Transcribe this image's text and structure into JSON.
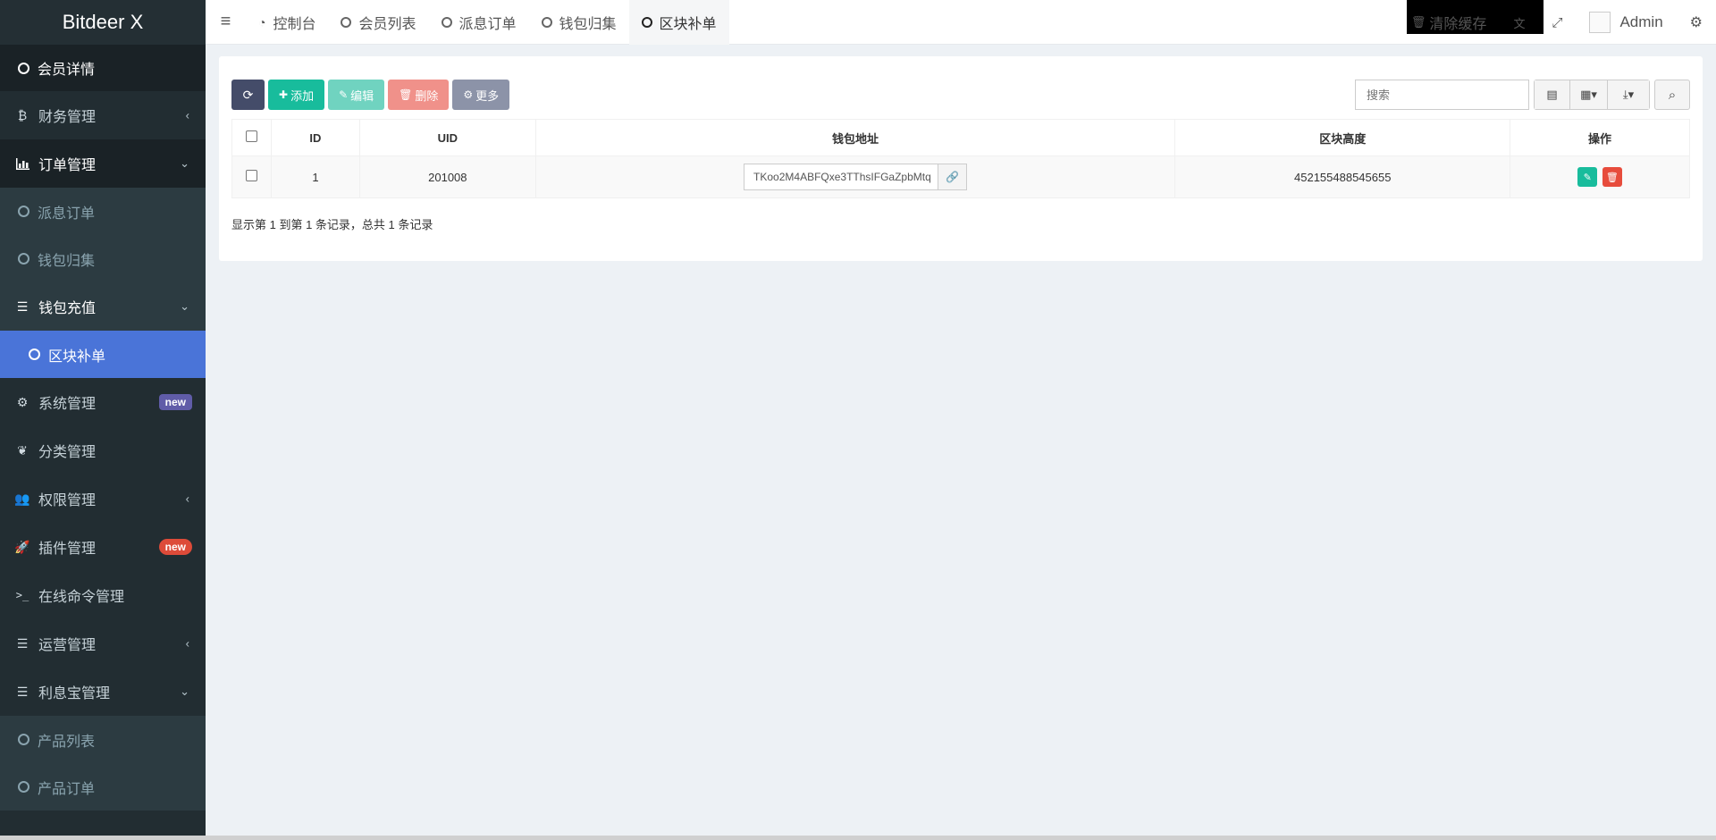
{
  "sidebar": {
    "brand": "Bitdeer X",
    "items": [
      {
        "label": "会员详情",
        "type": "sub",
        "state": "member"
      },
      {
        "label": "财务管理",
        "icon": "bitcoin-icon",
        "chev": "‹"
      },
      {
        "label": "订单管理",
        "icon": "bar-chart-icon",
        "chev": "⌄",
        "state": "open"
      },
      {
        "label": "派息订单",
        "type": "sub"
      },
      {
        "label": "钱包归集",
        "type": "sub"
      },
      {
        "label": "钱包充值",
        "icon": "list-icon",
        "chev": "⌄",
        "state": "open"
      },
      {
        "label": "区块补单",
        "type": "sub",
        "state": "active"
      },
      {
        "label": "系统管理",
        "icon": "cogs-icon",
        "badge": "new"
      },
      {
        "label": "分类管理",
        "icon": "leaf-icon"
      },
      {
        "label": "权限管理",
        "icon": "group-icon",
        "chev": "‹"
      },
      {
        "label": "插件管理",
        "icon": "rocket-icon",
        "badge": "new"
      },
      {
        "label": "在线命令管理",
        "icon": "terminal-icon"
      },
      {
        "label": "运营管理",
        "icon": "list-icon",
        "chev": "‹"
      },
      {
        "label": "利息宝管理",
        "icon": "list-icon",
        "chev": "⌄"
      },
      {
        "label": "产品列表",
        "type": "sub"
      },
      {
        "label": "产品订单",
        "type": "sub"
      }
    ]
  },
  "header": {
    "tabs": [
      {
        "label": "控制台",
        "icon": "dashboard-icon"
      },
      {
        "label": "会员列表"
      },
      {
        "label": "派息订单"
      },
      {
        "label": "钱包归集"
      },
      {
        "label": "区块补单",
        "active": true
      }
    ],
    "clear_cache": "清除缓存",
    "user": "Admin"
  },
  "toolbar": {
    "add": "添加",
    "edit": "编辑",
    "delete": "删除",
    "more": "更多"
  },
  "search": {
    "placeholder": "搜索"
  },
  "table": {
    "columns": [
      "ID",
      "UID",
      "钱包地址",
      "区块高度",
      "操作"
    ],
    "rows": [
      {
        "id": "1",
        "uid": "201008",
        "address": "TKoo2M4ABFQxe3TThsIFGaZpbMtq",
        "height": "452155488545655"
      }
    ]
  },
  "pagination_text": "显示第 1 到第 1 条记录，总共 1 条记录",
  "colors": {
    "sidebar": "#222d32",
    "active": "#4a74d8",
    "success": "#18bc9c",
    "danger": "#e74c3c"
  }
}
